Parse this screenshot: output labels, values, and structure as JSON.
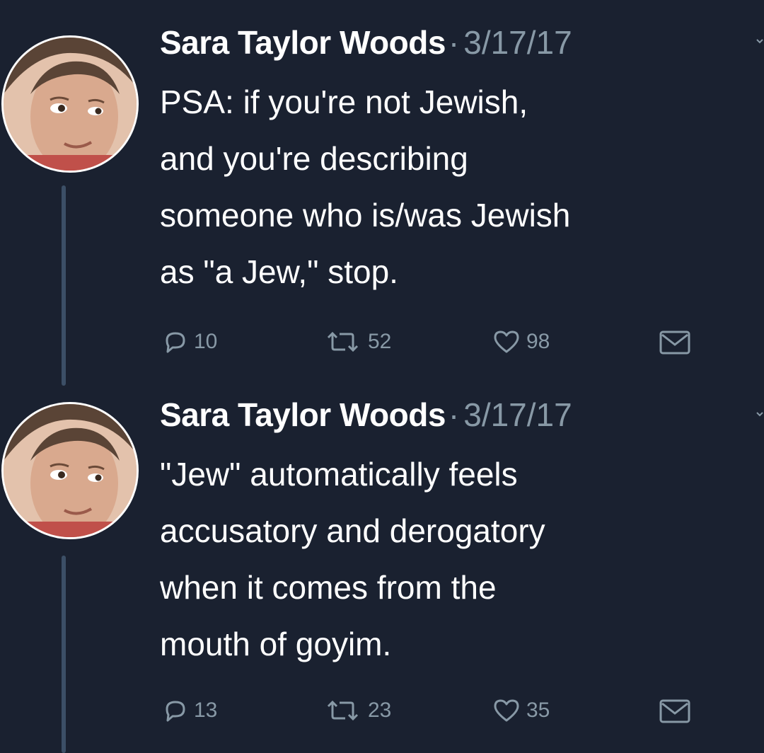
{
  "colors": {
    "background": "#1a2130",
    "text": "#ffffff",
    "secondary_text": "#8899a6",
    "thread_line": "#3c4f66"
  },
  "tweets": [
    {
      "author": "Sara Taylor Woods",
      "separator": "·",
      "date": "3/17/17",
      "text_lines": [
        "PSA: if you're not Jewish,",
        "and you're describing",
        "someone who is/was Jewish",
        "as \"a Jew,\" stop."
      ],
      "reply_count": "10",
      "retweet_count": "52",
      "like_count": "98",
      "icons": [
        "reply-icon",
        "retweet-icon",
        "heart-icon",
        "envelope-icon"
      ]
    },
    {
      "author": "Sara Taylor Woods",
      "separator": "·",
      "date": "3/17/17",
      "text_lines": [
        "\"Jew\" automatically feels",
        "accusatory and derogatory",
        "when it comes from the",
        "mouth of goyim."
      ],
      "reply_count": "13",
      "retweet_count": "23",
      "like_count": "35",
      "icons": [
        "reply-icon",
        "retweet-icon",
        "heart-icon",
        "envelope-icon"
      ]
    }
  ]
}
